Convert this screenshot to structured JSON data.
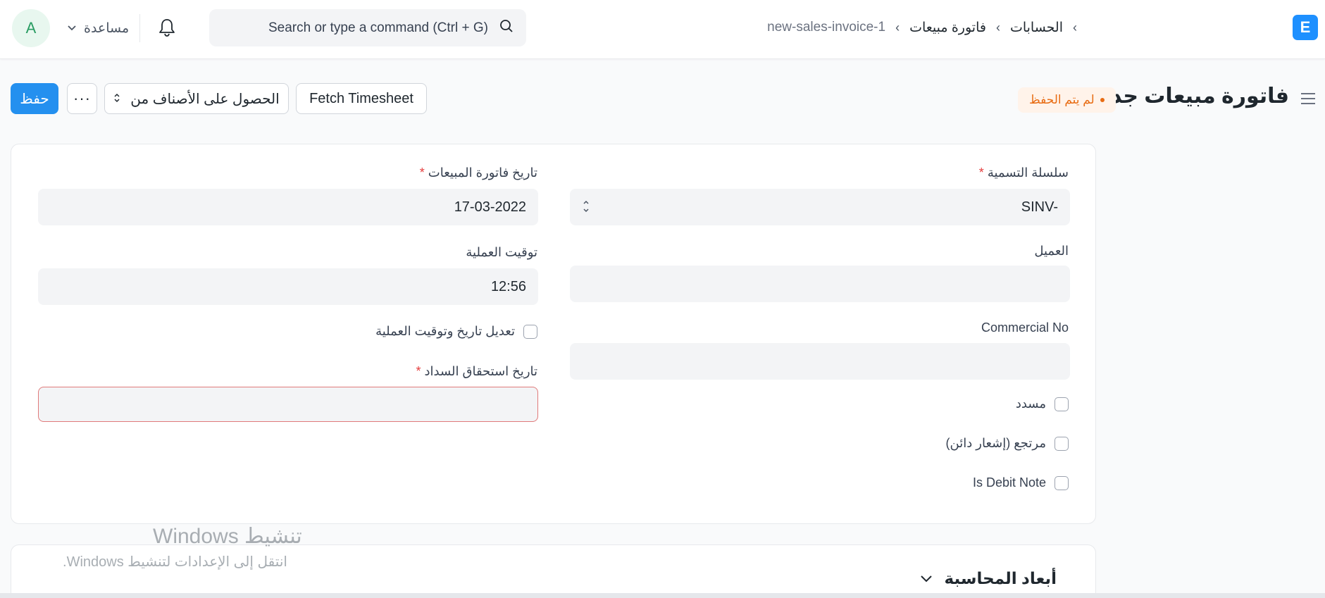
{
  "navbar": {
    "avatar_letter": "A",
    "help_label": "مساعدة",
    "search_placeholder": "Search or type a command (Ctrl + G)",
    "breadcrumbs": [
      "الحسابات",
      "فاتورة مبيعات",
      "new-sales-invoice-1"
    ],
    "app_logo_letter": "E"
  },
  "page_head": {
    "title": "فاتورة مبيعات جديد",
    "status": "لم يتم الحفظ",
    "save_label": "حفظ",
    "more_label": "···",
    "get_items_label": "الحصول على الأصناف من",
    "fetch_timesheet_label": "Fetch Timesheet"
  },
  "form": {
    "naming_series": {
      "label": "سلسلة التسمية",
      "value": "SINV-"
    },
    "customer": {
      "label": "العميل",
      "value": ""
    },
    "commercial_no": {
      "label": "Commercial No",
      "value": ""
    },
    "is_paid": {
      "label": "مسدد"
    },
    "is_return": {
      "label": "مرتجع (إشعار دائن)"
    },
    "is_debit_note": {
      "label": "Is Debit Note"
    },
    "posting_date": {
      "label": "تاريخ فاتورة المبيعات",
      "value": "17-03-2022"
    },
    "posting_time": {
      "label": "توقيت العملية",
      "value": "12:56"
    },
    "edit_posting": {
      "label": "تعديل تاريخ وتوقيت العملية"
    },
    "due_date": {
      "label": "تاريخ استحقاق السداد",
      "value": ""
    },
    "required_mark": "*"
  },
  "sections": {
    "accounting_dimensions": "أبعاد المحاسبة"
  },
  "watermark": {
    "title": "تنشيط Windows",
    "subtitle": "انتقل إلى الإعدادات لتنشيط Windows."
  },
  "colors": {
    "primary": "#2490ef",
    "status_orange": "#e86c13",
    "required_red": "#e53e3e"
  }
}
